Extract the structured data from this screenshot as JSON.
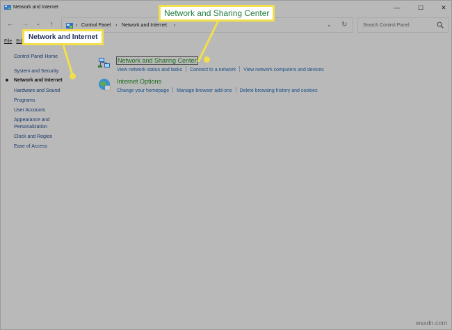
{
  "window": {
    "title": "Network and Internet",
    "controls": {
      "minimize": "—",
      "maximize": "☐",
      "close": "✕"
    }
  },
  "nav": {
    "back": "←",
    "forward": "→",
    "recent": "⌄",
    "up": "↑",
    "breadcrumbs": [
      "Control Panel",
      "Network and Internet"
    ],
    "breadcrumb_separator": "›",
    "dropdown": "⌄",
    "refresh": "↻"
  },
  "search": {
    "placeholder": "Search Control Panel"
  },
  "menu": {
    "file": "File",
    "edit": "Ed"
  },
  "sidebar": {
    "items": [
      {
        "label": "Control Panel Home"
      },
      {
        "label": "System and Security"
      },
      {
        "label": "Network and Internet",
        "active": true
      },
      {
        "label": "Hardware and Sound"
      },
      {
        "label": "Programs"
      },
      {
        "label": "User Accounts"
      },
      {
        "label": "Appearance and"
      },
      {
        "label": "Personalization"
      },
      {
        "label": "Clock and Region"
      },
      {
        "label": "Ease of Access"
      }
    ]
  },
  "main": {
    "categories": [
      {
        "title": "Network and Sharing Center",
        "tasks": [
          "View network status and tasks",
          "Connect to a network",
          "View network computers and devices"
        ]
      },
      {
        "title": "Internet Options",
        "tasks": [
          "Change your homepage",
          "Manage browser add-ons",
          "Delete browsing history and cookies"
        ]
      }
    ]
  },
  "callouts": {
    "top": "Network and Sharing Center",
    "left": "Network and Internet",
    "color": "#f2e04a"
  },
  "watermark": "wsxdn.com"
}
